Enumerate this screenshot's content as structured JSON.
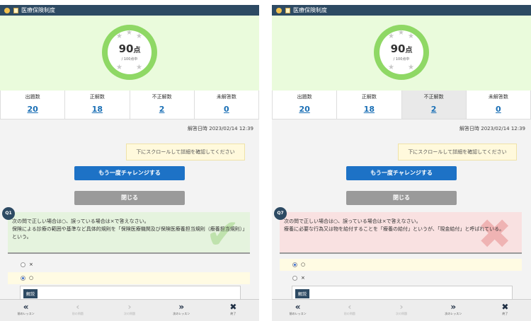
{
  "screens": [
    {
      "header_title": "医療保険制度",
      "score_value": "90",
      "score_unit": "点",
      "score_total": "/ 100点中",
      "stats": [
        {
          "label": "出題数",
          "value": "20"
        },
        {
          "label": "正解数",
          "value": "18"
        },
        {
          "label": "不正解数",
          "value": "2"
        },
        {
          "label": "未解答数",
          "value": "0"
        }
      ],
      "answer_date": "解答日時 2023/02/14 12:39",
      "scroll_note": "下にスクロールして詳細を確認してください",
      "retry_label": "もう一度チャレンジする",
      "close_label": "閉じる",
      "question": {
        "number": "Q1",
        "result": "correct",
        "line1": "次の問で正しい場合は○、誤っている場合は×で答えなさい。",
        "line2": "保険による診療の範囲や基準など具体的規則を「保険医療機関及び保険医療養担当規則（療養担当規則）」という。",
        "options": [
          {
            "label": "×",
            "selected": false
          },
          {
            "label": "○",
            "selected": true
          }
        ],
        "explanation_tag": "解説"
      }
    },
    {
      "header_title": "医療保険制度",
      "score_value": "90",
      "score_unit": "点",
      "score_total": "/ 100点中",
      "stats": [
        {
          "label": "出題数",
          "value": "20"
        },
        {
          "label": "正解数",
          "value": "18"
        },
        {
          "label": "不正解数",
          "value": "2"
        },
        {
          "label": "未解答数",
          "value": "0"
        }
      ],
      "answer_date": "解答日時 2023/02/14 12:39",
      "scroll_note": "下にスクロールして詳細を確認してください",
      "retry_label": "もう一度チャレンジする",
      "close_label": "閉じる",
      "question": {
        "number": "Q7",
        "result": "incorrect",
        "line1": "次の問で正しい場合は○、誤っている場合は×で答えなさい。",
        "line2": "療養に必要な行為又は物を給付することを「療養の給付」というが、「現金給付」と呼ばれている。",
        "options": [
          {
            "label": "○",
            "selected": true
          },
          {
            "label": "×",
            "selected": false
          }
        ],
        "explanation_tag": "解説"
      }
    }
  ],
  "footer": [
    {
      "glyph": "«",
      "label": "前のレッスン"
    },
    {
      "glyph": "‹",
      "label": "前の問題"
    },
    {
      "glyph": "›",
      "label": "次の問題"
    },
    {
      "glyph": "»",
      "label": "次のレッスン"
    },
    {
      "glyph": "✖",
      "label": "終了"
    }
  ],
  "colors": {
    "header": "#2d4a63",
    "ring": "#8fd865",
    "link": "#1a6fb5",
    "retry": "#1d72c6",
    "close": "#9a9a9a",
    "correct_bg": "#e5f3de",
    "incorrect_bg": "#f9e1e1"
  },
  "icons": {
    "correct_mark": "checkmark-icon",
    "incorrect_mark": "cross-icon"
  }
}
